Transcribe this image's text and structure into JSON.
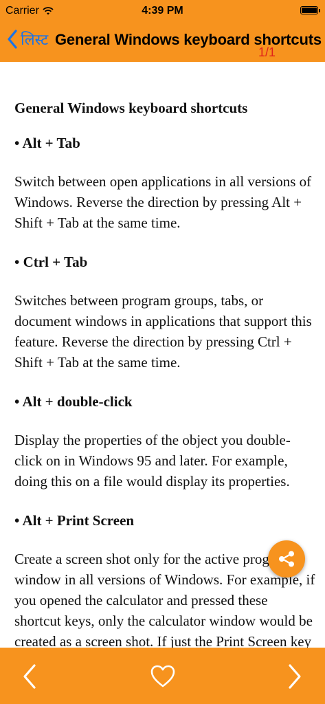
{
  "status": {
    "carrier": "Carrier",
    "time": "4:39 PM"
  },
  "nav": {
    "back_label": "लिस्ट",
    "title": "General Windows keyboard shortcuts",
    "page_counter": "1/1"
  },
  "content": {
    "heading": "General Windows keyboard shortcuts",
    "items": [
      {
        "title": "• Alt + Tab",
        "desc": "Switch between open applications in all versions of Windows. Reverse the direction by pressing Alt + Shift + Tab at the same time."
      },
      {
        "title": "• Ctrl + Tab",
        "desc": "Switches between program groups, tabs, or document windows in applications that support this feature. Reverse the direction by pressing Ctrl + Shift + Tab at the same time."
      },
      {
        "title": "• Alt + double-click",
        "desc": "Display the properties of the object you double-click on in Windows 95 and later. For example, doing this on a file would display its properties."
      },
      {
        "title": "• Alt + Print Screen",
        "desc": "Create a screen shot only for the active program window in all versions of Windows. For example, if you opened the calculator and pressed these shortcut keys, only the calculator window would be created as a screen shot. If just the Print Screen key is pressed"
      }
    ]
  },
  "colors": {
    "accent": "#f7931e",
    "back": "#1a73e8",
    "counter": "#e0221a"
  },
  "icons": {
    "back": "chevron-left-icon",
    "share": "share-icon",
    "prev": "chevron-left-icon",
    "favorite": "heart-icon",
    "next": "chevron-right-icon"
  }
}
